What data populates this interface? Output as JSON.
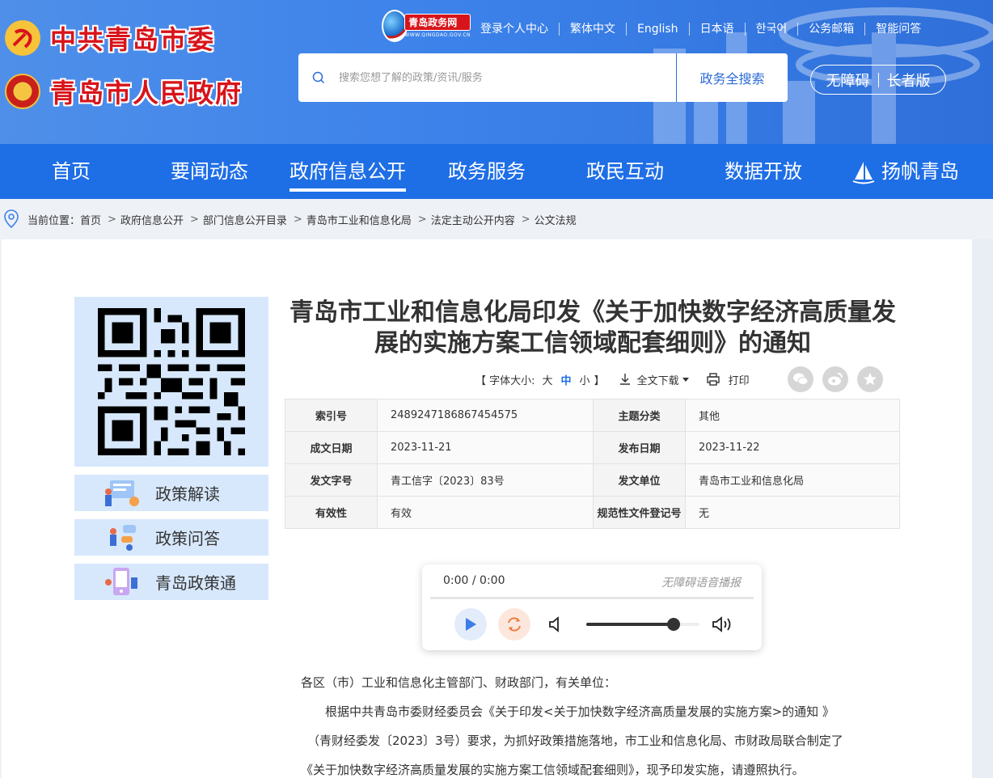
{
  "header": {
    "party_name": "中共青岛市委",
    "gov_name": "青岛市人民政府",
    "portal_name": "青岛政务网",
    "portal_domain": "WWW.QINGDAO.GOV.CN",
    "top_links": [
      "登录个人中心",
      "繁体中文",
      "English",
      "日本语",
      "한국어",
      "公务邮箱",
      "智能问答"
    ],
    "search": {
      "placeholder": "搜索您想了解的政策/资讯/服务",
      "button": "政务全搜索"
    },
    "accessibility": [
      "无障碍",
      "长者版"
    ]
  },
  "nav": {
    "items": [
      "首页",
      "要闻动态",
      "政府信息公开",
      "政务服务",
      "政民互动",
      "数据开放",
      "扬帆青岛"
    ],
    "active_index": 2
  },
  "breadcrumb": {
    "label": "当前位置：",
    "items": [
      "首页",
      "政府信息公开",
      "部门信息公开目录",
      "青岛市工业和信息化局",
      "法定主动公开内容",
      "公文法规"
    ],
    "separator": ">"
  },
  "sidebar": {
    "cards": [
      "政策解读",
      "政策问答",
      "青岛政策通"
    ]
  },
  "article": {
    "title_line1": "青岛市工业和信息化局印发《关于加快数字经济高质量发",
    "title_line2": "展的实施方案工信领域配套细则》的通知",
    "tools": {
      "font_prefix": "【 字体大小:",
      "sizes": [
        "大",
        "中",
        "小"
      ],
      "font_suffix": "】",
      "active_size": "中",
      "download": "全文下载",
      "print": "打印"
    },
    "meta": [
      [
        {
          "k": "索引号",
          "v": "2489247186867454575"
        },
        {
          "k": "主题分类",
          "v": "其他"
        }
      ],
      [
        {
          "k": "成文日期",
          "v": "2023-11-21"
        },
        {
          "k": "发布日期",
          "v": "2023-11-22"
        }
      ],
      [
        {
          "k": "发文字号",
          "v": "青工信字〔2023〕83号"
        },
        {
          "k": "发文单位",
          "v": "青岛市工业和信息化局"
        }
      ],
      [
        {
          "k": "有效性",
          "v": "有效"
        },
        {
          "k": "规范性文件登记号",
          "v": "无"
        }
      ]
    ],
    "player": {
      "time": "0:00 / 0:00",
      "label": "无障碍语音播报",
      "volume": 0.77
    },
    "body": {
      "salutation": "各区（市）工业和信息化主管部门、财政部门，有关单位：",
      "line1": "根据中共青岛市委财经委员会《关于印发<关于加快数字经济高质量发展的实施方案>的通知 》",
      "line2": "（青财经委发〔2023〕3号）要求，为抓好政策措施落地，市工业和信息化局、市财政局联合制定了",
      "line3": "《关于加快数字经济高质量发展的实施方案工信领域配套细则》，现予印发实施，请遵照执行。"
    }
  },
  "colors": {
    "nav": "#1e6ee6",
    "header": "#3c82ea",
    "logo_red": "#d7141a",
    "side_card": "#d7e8fc"
  }
}
